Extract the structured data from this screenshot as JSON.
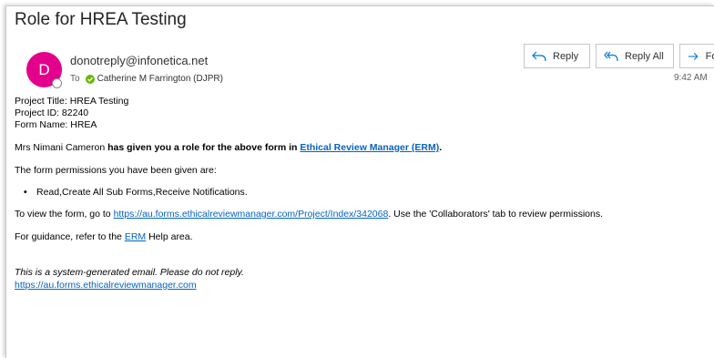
{
  "email": {
    "subject": "Role for HREA Testing",
    "sender_initial": "D",
    "sender": "donotreply@infonetica.net",
    "to_label": "To",
    "recipient": "Catherine M Farrington (DJPR)",
    "time": "9:42 AM",
    "avatar_color": "#e3008c",
    "presence_color": "#6bb700"
  },
  "actions": {
    "reply": "Reply",
    "reply_all": "Reply All",
    "forward": "Forward"
  },
  "body": {
    "project_title": "Project Title: HREA Testing",
    "project_id": "Project ID: 82240",
    "form_name": "Form Name: HREA",
    "role_prefix": "Mrs Nimani Cameron ",
    "role_bold": "has given you a role for the above form in ",
    "role_link": "Ethical Review Manager (ERM)",
    "role_suffix": ".",
    "permissions_intro": "The form permissions you have been given are:",
    "permissions": [
      "Read,Create All Sub Forms,Receive Notifications."
    ],
    "view_prefix": "To view the form, go to ",
    "view_link": "https://au.forms.ethicalreviewmanager.com/Project/Index/342068",
    "view_suffix": ". Use the 'Collaborators' tab to review permissions.",
    "guidance_prefix": "For guidance, refer to the ",
    "guidance_link": "ERM",
    "guidance_suffix": " Help area.",
    "disclaimer": "This is a system-generated email. Please do not reply.",
    "site_link": "https://au.forms.ethicalreviewmanager.com"
  }
}
